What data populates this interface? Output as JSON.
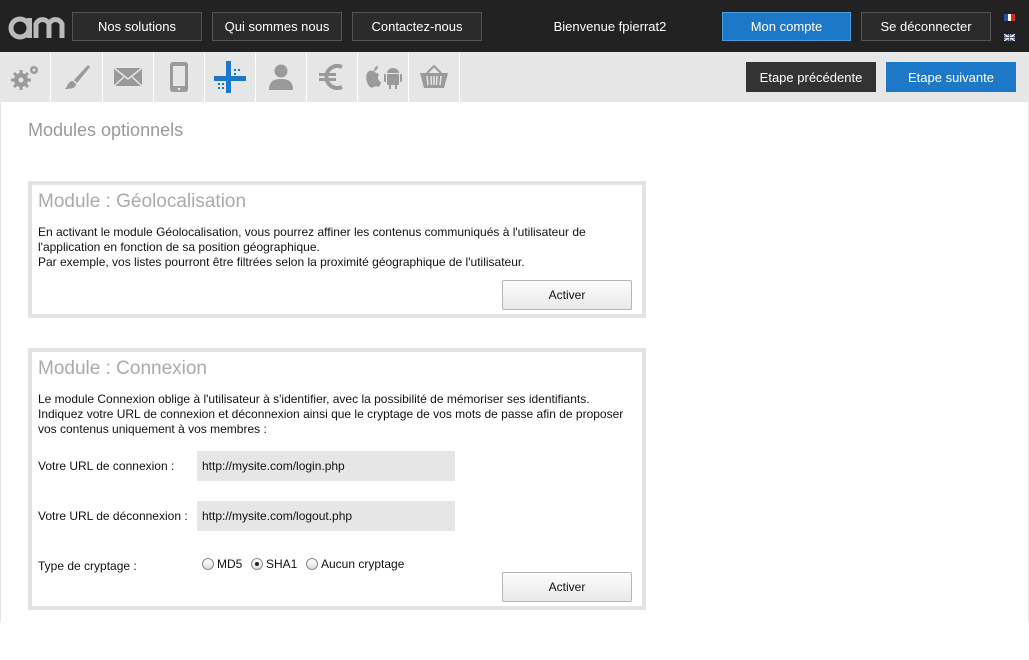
{
  "header": {
    "logo_text": "am",
    "nav": [
      "Nos solutions",
      "Qui sommes nous",
      "Contactez-nous"
    ],
    "welcome": "Bienvenue fpierrat2",
    "account_label": "Mon compte",
    "logout_label": "Se déconnecter",
    "languages": [
      "fr",
      "en"
    ]
  },
  "toolbar": {
    "tools": [
      "gear-icon",
      "brush-icon",
      "mail-icon",
      "phone-icon",
      "modules-icon",
      "user-icon",
      "euro-icon",
      "apple-android-icon",
      "basket-icon"
    ],
    "prev_label": "Etape précédente",
    "next_label": "Etape suivante"
  },
  "page": {
    "title": "Modules optionnels"
  },
  "geo_module": {
    "title": "Module : Géolocalisation",
    "desc_line1": "En activant le module Géolocalisation, vous pourrez affiner les contenus communiqués à l'utilisateur de",
    "desc_line2": "l'application en fonction de sa position géographique.",
    "desc_line3": "Par exemple, vos listes pourront être filtrées selon la proximité géographique de l'utilisateur.",
    "button": "Activer"
  },
  "login_module": {
    "title": "Module : Connexion",
    "desc_line1": "Le module Connexion oblige à l'utilisateur à s'identifier, avec la possibilité de mémoriser ses identifiants.",
    "desc_line2": "Indiquez votre URL de connexion et déconnexion ainsi que le cryptage de vos mots de passe afin de proposer",
    "desc_line3": "vos contenus uniquement à vos membres :",
    "login_url_label": "Votre URL de connexion :",
    "login_url_value": "http://mysite.com/login.php",
    "logout_url_label": "Votre URL de déconnexion :",
    "logout_url_value": "http://mysite.com/logout.php",
    "crypt_label": "Type de cryptage :",
    "crypt_options": [
      "MD5",
      "SHA1",
      "Aucun cryptage"
    ],
    "crypt_selected": "SHA1",
    "button": "Activer"
  },
  "colors": {
    "accent_blue": "#1e78c8",
    "topbar": "#222222",
    "toolbar_bg": "#e6e6e6",
    "icon_gray": "#9a9a9a",
    "active_icon": "#1e78c8"
  }
}
